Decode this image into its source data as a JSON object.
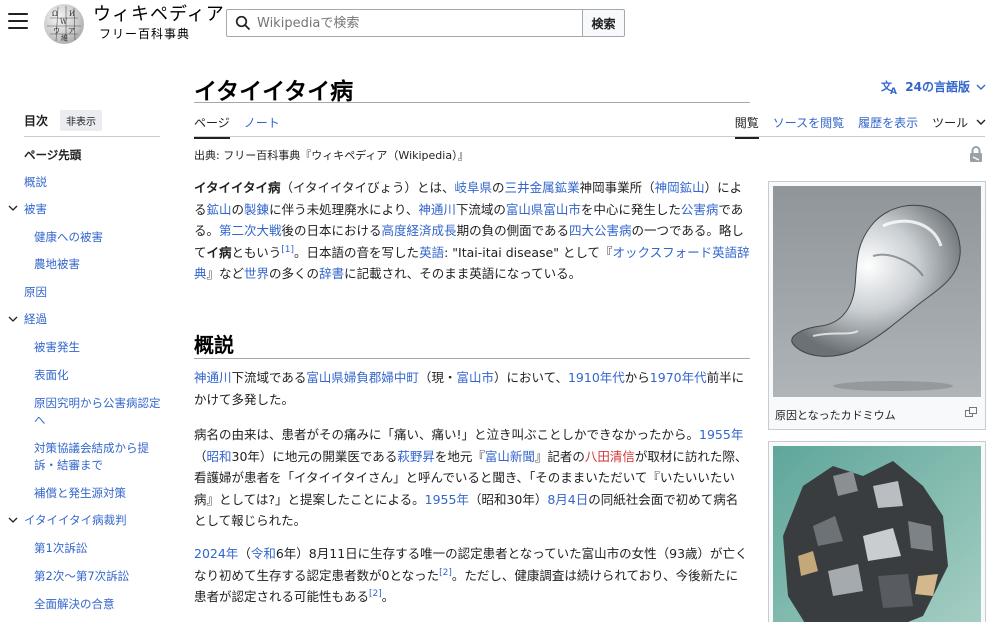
{
  "header": {
    "wordmark_title": "ウィキペディア",
    "wordmark_tagline": "フリー百科事典",
    "search_placeholder": "Wikipediaで検索",
    "search_button": "検索"
  },
  "toc": {
    "title": "目次",
    "hide": "非表示",
    "items": [
      {
        "label": "ページ先頭"
      },
      {
        "label": "概説"
      },
      {
        "label": "被害"
      },
      {
        "label": "健康への被害"
      },
      {
        "label": "農地被害"
      },
      {
        "label": "原因"
      },
      {
        "label": "経過"
      },
      {
        "label": "被害発生"
      },
      {
        "label": "表面化"
      },
      {
        "label": "原因究明から公害病認定へ"
      },
      {
        "label": "対策協議会結成から提訴・結審まで"
      },
      {
        "label": "補償と発生源対策"
      },
      {
        "label": "イタイイタイ病裁判"
      },
      {
        "label": "第1次訴訟"
      },
      {
        "label": "第2次〜第7次訴訟"
      },
      {
        "label": "全面解決の合意"
      }
    ]
  },
  "article": {
    "title": "イタイイタイ病",
    "languages": "24の言語版",
    "tabs_left": [
      "ページ",
      "ノート"
    ],
    "tabs_right": [
      "閲覧",
      "ソースを閲覧",
      "履歴を表示",
      "ツール"
    ],
    "source_line": "出典: フリー百科事典『ウィキペディア（Wikipedia）』",
    "section_heading": "概説",
    "images": [
      {
        "caption": "原因となったカドミウム"
      },
      {
        "caption": ""
      }
    ],
    "intro": {
      "t1": "イタイイタイ病",
      "t2": "（イタイイタイびょう）とは、",
      "t3": "岐阜県",
      "t4": "の",
      "t5": "三井金属鉱業",
      "t6": "神岡事業所（",
      "t7": "神岡鉱山",
      "t8": "）による",
      "t9": "鉱山",
      "t10": "の",
      "t11": "製錬",
      "t12": "に伴う未処理廃水により、",
      "t13": "神通川",
      "t14": "下流域の",
      "t15": "富山県富山市",
      "t16": "を中心に発生した",
      "t17": "公害病",
      "t18": "である。",
      "t19": "第二次大戦",
      "t20": "後の日本における",
      "t21": "高度経済成長",
      "t22": "期の負の側面である",
      "t23": "四大公害病",
      "t24": "の一つである。略して",
      "t25": "イ病",
      "t26": "ともいう",
      "t27": "[1]",
      "t28": "。日本語の音を写した",
      "t29": "英語",
      "t30": ": \"Itai-itai disease\" として『",
      "t31": "オックスフォード英語辞典",
      "t32": "』など",
      "t33": "世界",
      "t34": "の多くの",
      "t35": "辞書",
      "t36": "に記載され、そのまま英語になっている。"
    },
    "p1": {
      "t1": "神通川",
      "t2": "下流域である",
      "t3": "富山県婦負郡婦中町",
      "t4": "（現・",
      "t5": "富山市",
      "t6": "）において、",
      "t7": "1910年代",
      "t8": "から",
      "t9": "1970年代",
      "t10": "前半にかけて多発した。"
    },
    "p2": {
      "t1": "病名の由来は、患者がその痛みに「痛い、痛い!」と泣き叫ぶことしかできなかったから。",
      "t2": "1955年",
      "t3": "（",
      "t4": "昭和",
      "t5": "30年）に地元の開業医である",
      "t6": "萩野昇",
      "t7": "を地元『",
      "t8": "富山新聞",
      "t9": "』記者の",
      "t10": "八田清信",
      "t11": "が取材に訪れた際、看護婦が患者を「イタイイタイさん」と呼んでいると聞き、「そのままいただいて『いたいいたい病』としては?」と提案したことによる。",
      "t12": "1955年",
      "t13": "（昭和30年）",
      "t14": "8月4日",
      "t15": "の同紙社会面で初めて病名として報じられた。"
    },
    "p3": {
      "t1": "2024年",
      "t2": "（",
      "t3": "令和",
      "t4": "6年）8月11日に生存する唯一の認定患者となっていた富山市の女性（93歳）が亡くなり初めて生存する認定患者数が0となった",
      "t5": "[2]",
      "t6": "。ただし、健康調査は続けられており、今後新たに患者が認定される可能性もある",
      "t7": "[2]",
      "t8": "。"
    }
  },
  "colors": {
    "link": "#3366cc",
    "redlink": "#d73333",
    "text": "#202122"
  }
}
